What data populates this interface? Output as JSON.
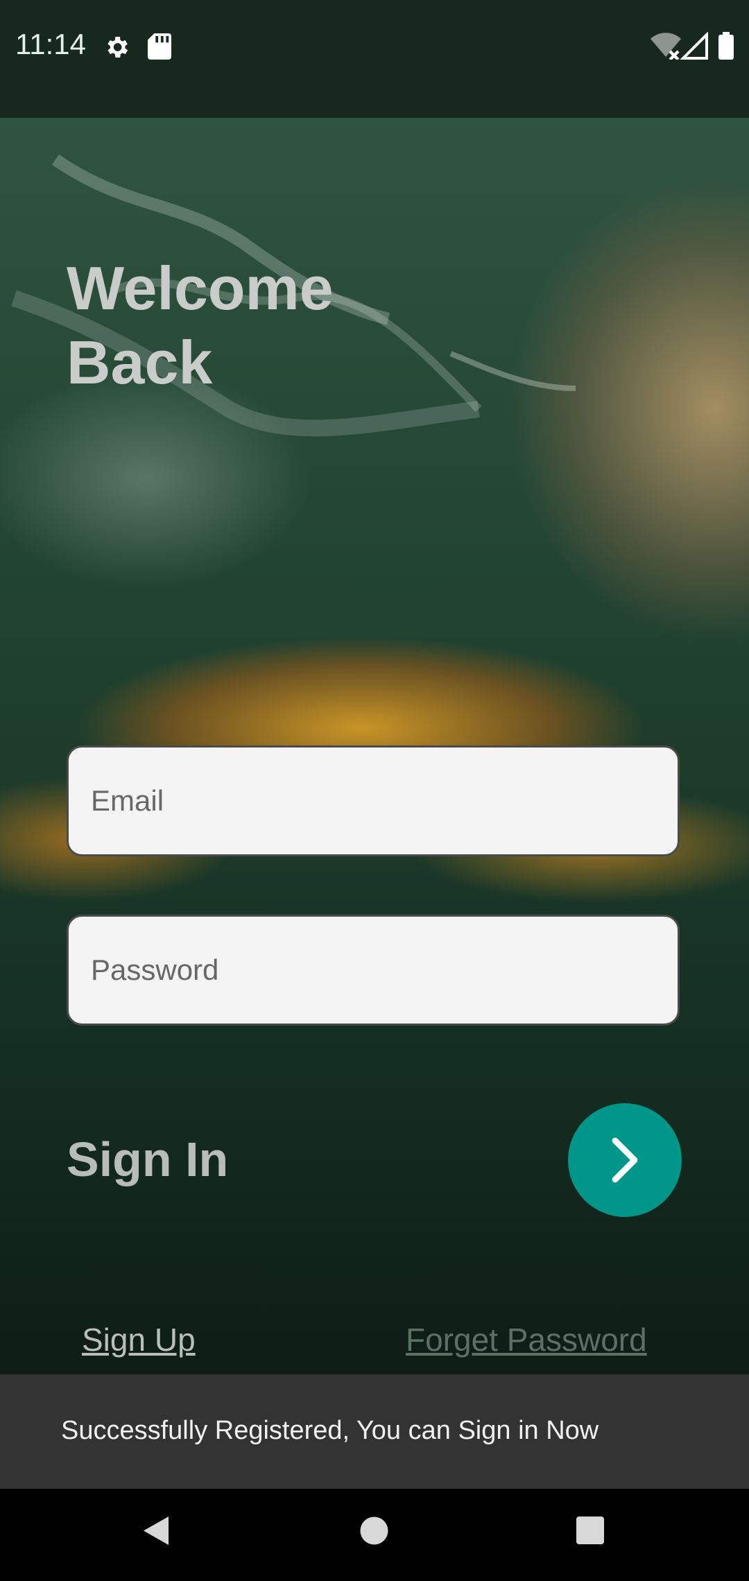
{
  "status_bar": {
    "time": "11:14",
    "icons": [
      "gear-icon",
      "sd-card-icon",
      "wifi-off-icon",
      "cell-signal-icon",
      "battery-icon"
    ]
  },
  "screen": {
    "title_line1": "Welcome",
    "title_line2": "Back",
    "email_placeholder": "Email",
    "password_placeholder": "Password",
    "sign_in_label": "Sign In",
    "sign_up_link": "Sign Up",
    "forget_password_link": "Forget Password",
    "accent_color": "#00968a"
  },
  "snackbar": {
    "message": "Successfully Registered, You can Sign in Now"
  },
  "nav_bar": {
    "buttons": [
      "back-icon",
      "home-icon",
      "recents-icon"
    ]
  }
}
